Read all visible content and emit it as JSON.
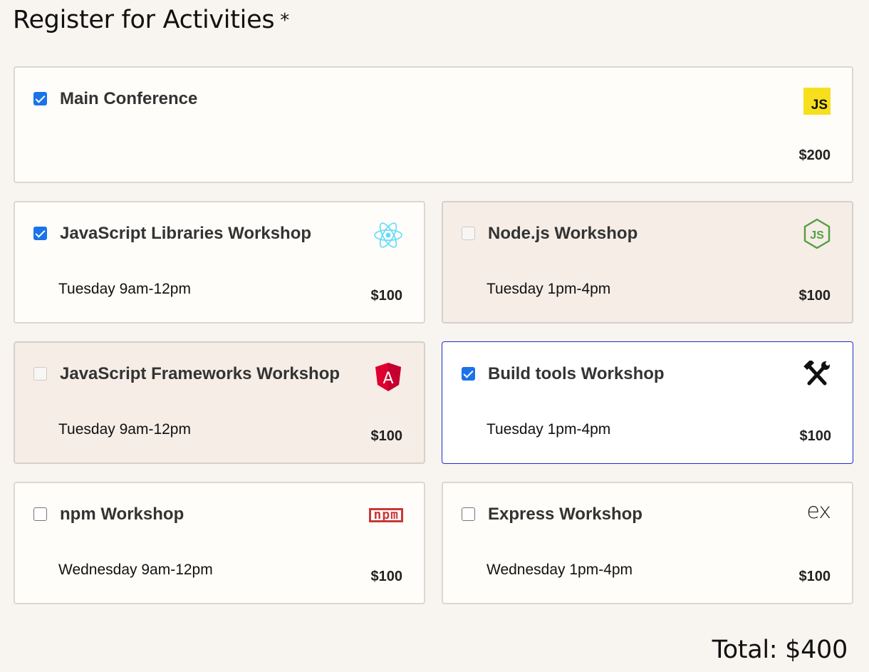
{
  "page": {
    "heading": "Register for Activities",
    "required_marker": "*",
    "total_label": "Total: $400"
  },
  "activities": [
    {
      "title": "Main Conference",
      "time": "",
      "price": "$200",
      "checked": true,
      "disabled": false,
      "icon": "javascript-logo-icon",
      "icon_text": "JS"
    },
    {
      "title": "JavaScript Libraries Workshop",
      "time": "Tuesday 9am-12pm",
      "price": "$100",
      "checked": true,
      "disabled": false,
      "icon": "react-logo-icon"
    },
    {
      "title": "Node.js Workshop",
      "time": "Tuesday 1pm-4pm",
      "price": "$100",
      "checked": false,
      "disabled": true,
      "icon": "nodejs-logo-icon",
      "icon_text": "JS"
    },
    {
      "title": "JavaScript Frameworks Workshop",
      "time": "Tuesday 9am-12pm",
      "price": "$100",
      "checked": false,
      "disabled": true,
      "icon": "angular-logo-icon",
      "icon_text": "A"
    },
    {
      "title": "Build tools Workshop",
      "time": "Tuesday 1pm-4pm",
      "price": "$100",
      "checked": true,
      "disabled": false,
      "focused": true,
      "icon": "hammer-wrench-icon"
    },
    {
      "title": "npm Workshop",
      "time": "Wednesday 9am-12pm",
      "price": "$100",
      "checked": false,
      "disabled": false,
      "icon": "npm-logo-icon",
      "icon_text": "npm"
    },
    {
      "title": "Express Workshop",
      "time": "Wednesday 1pm-4pm",
      "price": "$100",
      "checked": false,
      "disabled": false,
      "icon": "express-logo-icon",
      "icon_text": "ex"
    }
  ],
  "colors": {
    "background": "#f8f4ef",
    "card": "#fefdf9",
    "card_disabled": "#f5ede6",
    "focus_border": "#1f2bd1",
    "checkbox_checked": "#1a73e8",
    "js_yellow": "#f7df1e",
    "react_cyan": "#61dafb",
    "node_green": "#539e43",
    "angular_red": "#dd0031",
    "npm_red": "#cb3837"
  }
}
